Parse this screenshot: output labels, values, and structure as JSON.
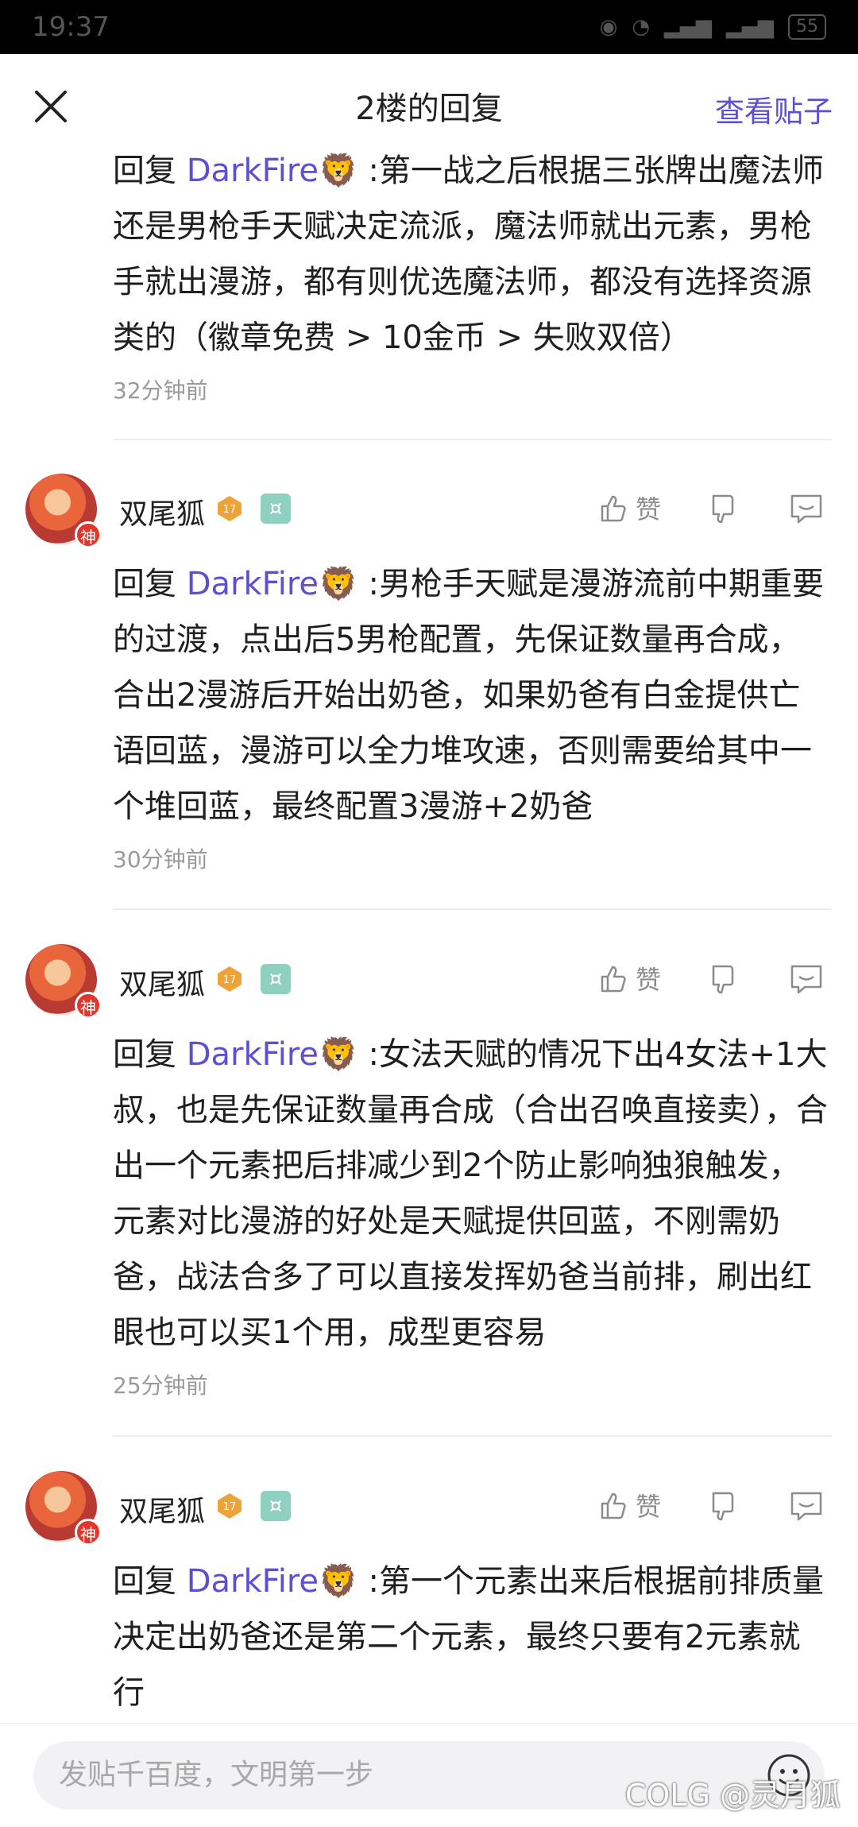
{
  "status_bar": {
    "time": "19:37",
    "battery": "55"
  },
  "header": {
    "title": "2楼的回复",
    "view_post": "查看贴子"
  },
  "first_reply": {
    "reply_prefix": "回复 ",
    "mention": "DarkFire🦁",
    "text": " :第一战之后根据三张牌出魔法师还是男枪手天赋决定流派，魔法师就出元素，男枪手就出漫游，都有则优选魔法师，都没有选择资源类的（徽章免费 > 10金币 > 失败双倍）",
    "time": "32分钟前"
  },
  "posts": [
    {
      "username": "双尾狐",
      "level": "17",
      "avatar_badge": "神",
      "like_label": "赞",
      "reply_prefix": "回复 ",
      "mention": "DarkFire🦁",
      "text": " :男枪手天赋是漫游流前中期重要的过渡，点出后5男枪配置，先保证数量再合成，合出2漫游后开始出奶爸，如果奶爸有白金提供亡语回蓝，漫游可以全力堆攻速，否则需要给其中一个堆回蓝，最终配置3漫游+2奶爸",
      "time": "30分钟前"
    },
    {
      "username": "双尾狐",
      "level": "17",
      "avatar_badge": "神",
      "like_label": "赞",
      "reply_prefix": "回复 ",
      "mention": "DarkFire🦁",
      "text": " :女法天赋的情况下出4女法+1大叔，也是先保证数量再合成（合出召唤直接卖），合出一个元素把后排减少到2个防止影响独狼触发，元素对比漫游的好处是天赋提供回蓝，不刚需奶爸，战法合多了可以直接发挥奶爸当前排，刷出红眼也可以买1个用，成型更容易",
      "time": "25分钟前"
    },
    {
      "username": "双尾狐",
      "level": "17",
      "avatar_badge": "神",
      "like_label": "赞",
      "reply_prefix": "回复 ",
      "mention": "DarkFire🦁",
      "text": " :第一个元素出来后根据前排质量决定出奶爸还是第二个元素，最终只要有2元素就行",
      "time": ""
    }
  ],
  "bottom_bar": {
    "input_placeholder": "发贴千百度，文明第一步"
  },
  "watermark": "COLG @灵月狐",
  "colors": {
    "accent": "#5b4fd6",
    "text": "#1f1f1f",
    "time": "#9a9a9a"
  }
}
